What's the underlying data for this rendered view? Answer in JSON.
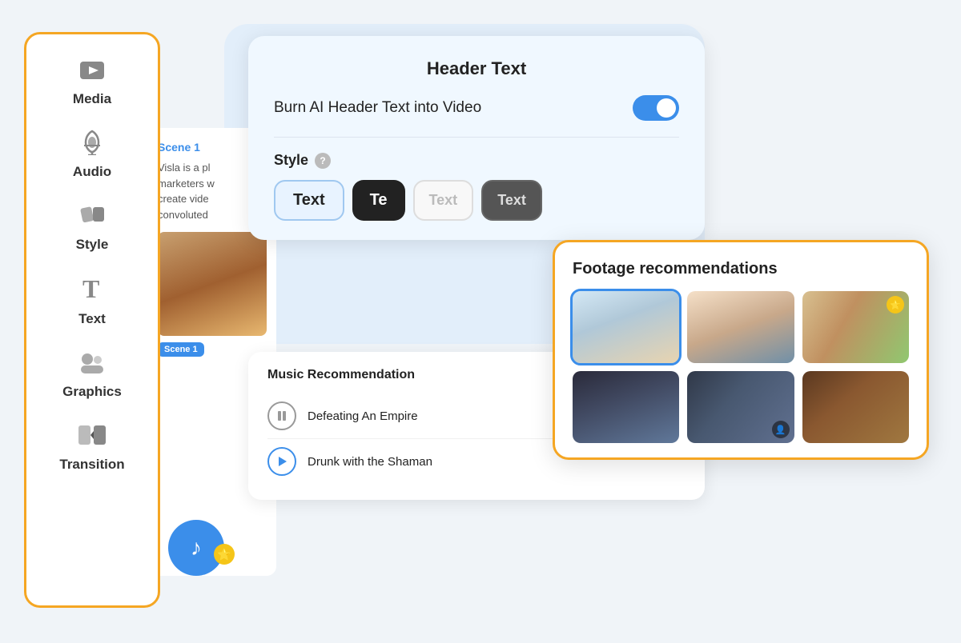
{
  "sidebar": {
    "items": [
      {
        "id": "media",
        "label": "Media",
        "icon": "▶"
      },
      {
        "id": "audio",
        "label": "Audio",
        "icon": "♪"
      },
      {
        "id": "style",
        "label": "Style",
        "icon": "🎨"
      },
      {
        "id": "text",
        "label": "Text",
        "icon": "T"
      },
      {
        "id": "graphics",
        "label": "Graphics",
        "icon": "👤"
      },
      {
        "id": "transition",
        "label": "Transition",
        "icon": "⬛"
      }
    ]
  },
  "scene_panel": {
    "scene_label": "Scene 1",
    "scene_text": "Visla is a pl marketers w create vide convoluted",
    "badge": "cene 1"
  },
  "header_text_card": {
    "title": "Header Text",
    "burn_label": "Burn AI Header Text into Video",
    "toggle_on": true,
    "style_label": "Style",
    "help_icon": "?",
    "style_options": [
      {
        "id": "text-light",
        "label": "Text",
        "variant": "light"
      },
      {
        "id": "text-dark",
        "label": "Te",
        "variant": "dark"
      },
      {
        "id": "text-outline-light",
        "label": "Text",
        "variant": "outline-light"
      },
      {
        "id": "text-outline-dark",
        "label": "Text",
        "variant": "outline-dark"
      }
    ]
  },
  "music_card": {
    "title": "Music Recommendation",
    "tracks": [
      {
        "id": "track1",
        "title": "Defeating An Empire",
        "playing": true
      },
      {
        "id": "track2",
        "title": "Drunk with the Shaman",
        "playing": false
      }
    ]
  },
  "footage_card": {
    "title": "Footage recommendations",
    "thumbs": [
      {
        "id": "ft1",
        "class": "ft1",
        "selected": true,
        "premium": false,
        "person": false
      },
      {
        "id": "ft2",
        "class": "ft2",
        "selected": false,
        "premium": false,
        "person": false
      },
      {
        "id": "ft3",
        "class": "ft3",
        "selected": false,
        "premium": true,
        "person": false
      },
      {
        "id": "ft4",
        "class": "ft4",
        "selected": false,
        "premium": false,
        "person": false
      },
      {
        "id": "ft5",
        "class": "ft5",
        "selected": false,
        "premium": false,
        "person": true
      },
      {
        "id": "ft6",
        "class": "ft6",
        "selected": false,
        "premium": false,
        "person": false
      }
    ]
  },
  "colors": {
    "accent_blue": "#3b8eea",
    "accent_orange": "#f5a623",
    "accent_yellow": "#f5c518"
  }
}
